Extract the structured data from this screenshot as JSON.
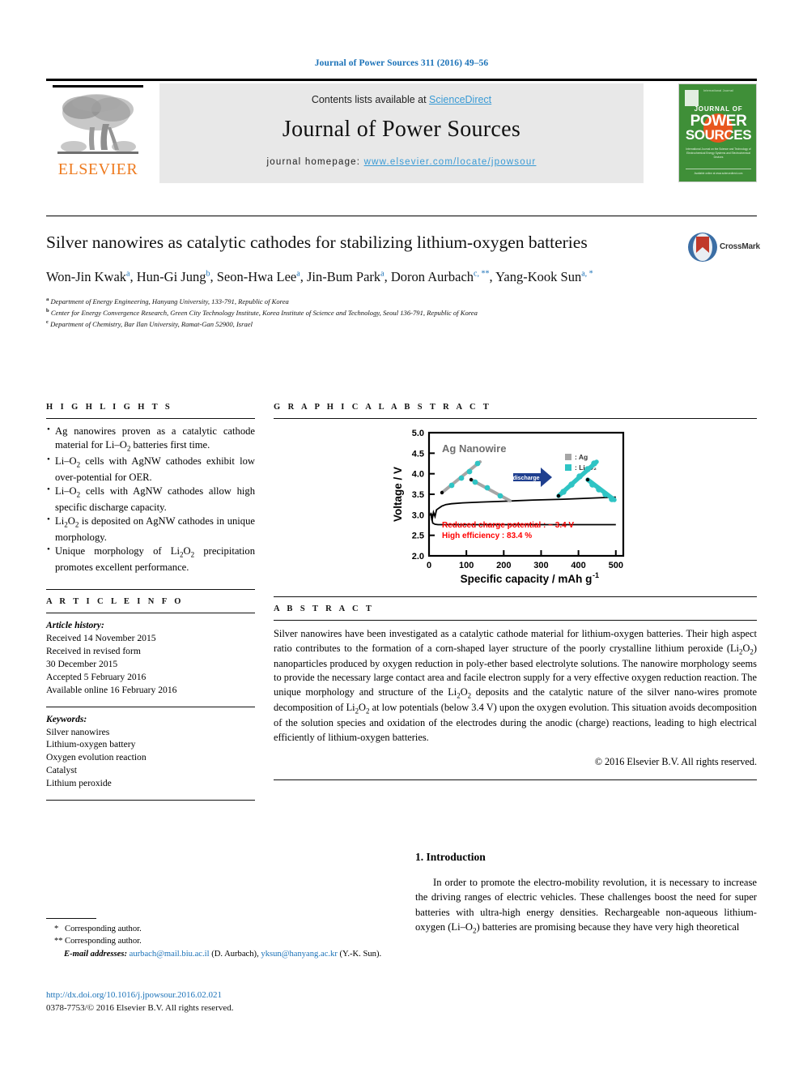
{
  "running_head": "Journal of Power Sources 311 (2016) 49–56",
  "masthead": {
    "contents_prefix": "Contents lists available at ",
    "sciencedirect": "ScienceDirect",
    "journal_name": "Journal of Power Sources",
    "homepage_label": "journal homepage: ",
    "homepage_url": "www.elsevier.com/locate/jpowsour",
    "elsevier_wordmark": "ELSEVIER",
    "elsevier_orange": "#ee7b20",
    "link_blue": "#3a9bd5"
  },
  "cover": {
    "top_line": "International Journal",
    "jof": "JOURNAL OF",
    "power": "POWER",
    "sources": "SOURCES",
    "subtitle": "International Journal on the Science and Technology of Electrochemical Energy Systems and Electrochemical Devices",
    "footer": "Available online at www.sciencedirect.com",
    "bg_color": "#3f8f38",
    "accent_color": "#e8561e"
  },
  "crossmark": {
    "label": "CrossMark"
  },
  "article": {
    "title": "Silver nanowires as catalytic cathodes for stabilizing lithium-oxygen batteries",
    "authors": [
      {
        "name": "Won-Jin Kwak",
        "marks": "a"
      },
      {
        "name": "Hun-Gi Jung",
        "marks": "b"
      },
      {
        "name": "Seon-Hwa Lee",
        "marks": "a"
      },
      {
        "name": "Jin-Bum Park",
        "marks": "a"
      },
      {
        "name": "Doron Aurbach",
        "marks": "c, **"
      },
      {
        "name": "Yang-Kook Sun",
        "marks": "a, *"
      }
    ],
    "affiliations": [
      {
        "mark": "a",
        "text": "Department of Energy Engineering, Hanyang University, 133-791, Republic of Korea"
      },
      {
        "mark": "b",
        "text": "Center for Energy Convergence Research, Green City Technology Institute, Korea Institute of Science and Technology, Seoul 136-791, Republic of Korea"
      },
      {
        "mark": "c",
        "text": "Department of Chemistry, Bar Ilan University, Ramat-Gan 52900, Israel"
      }
    ]
  },
  "highlights": {
    "heading": "H I G H L I G H T S",
    "items": [
      "Ag nanowires proven as a catalytic cathode material for Li–O<sub>2</sub> batteries first time.",
      "Li–O<sub>2</sub> cells with AgNW cathodes exhibit low over-potential for OER.",
      "Li–O<sub>2</sub> cells with AgNW cathodes allow high specific discharge capacity.",
      "Li<sub>2</sub>O<sub>2</sub> is deposited on AgNW cathodes in unique morphology.",
      "Unique morphology of Li<sub>2</sub>O<sub>2</sub> precipitation promotes excellent performance."
    ]
  },
  "graphical_abstract": {
    "heading": "G R A P H I C A L  A B S T R A C T"
  },
  "chart_data": {
    "type": "line",
    "title": "Ag Nanowire",
    "xlabel": "Specific capacity / mAh g",
    "xlabel_sup": "-1",
    "ylabel": "Voltage / V",
    "xlim": [
      0,
      520
    ],
    "ylim": [
      2.0,
      5.0
    ],
    "xticks": [
      0,
      100,
      200,
      300,
      400,
      500
    ],
    "yticks": [
      "2.0",
      "2.5",
      "3.0",
      "3.5",
      "4.0",
      "4.5",
      "5.0"
    ],
    "grid": false,
    "legend_position": "top-right",
    "legend": [
      {
        "label": ": Ag",
        "color": "#a6a6a6"
      },
      {
        "label": ": Li₂O₂",
        "color": "#2fc4c4"
      }
    ],
    "annotations": [
      {
        "text": "Reduced charge potential : ~ 3.4 V",
        "color": "#ff0000"
      },
      {
        "text": "High efficiency : 83.4 %",
        "color": "#ff0000"
      }
    ],
    "arrow_label": "discharge",
    "arrow_color": "#1f3f8f",
    "series": [
      {
        "name": "charge",
        "x": [
          5,
          8,
          12,
          16,
          20,
          26,
          34,
          45,
          60,
          90,
          140,
          200,
          280,
          360,
          440,
          500
        ],
        "y": [
          3.05,
          2.86,
          3.06,
          2.96,
          3.12,
          3.16,
          3.21,
          3.25,
          3.27,
          3.29,
          3.31,
          3.33,
          3.36,
          3.38,
          3.41,
          3.43
        ]
      },
      {
        "name": "discharge",
        "x": [
          5,
          10,
          16,
          24,
          40,
          80,
          160,
          260,
          360,
          450,
          500
        ],
        "y": [
          3.02,
          2.8,
          2.77,
          2.76,
          2.76,
          2.76,
          2.76,
          2.76,
          2.76,
          2.76,
          2.76
        ]
      }
    ]
  },
  "article_info": {
    "heading": "A R T I C L E  I N F O",
    "history_label": "Article history:",
    "history": [
      "Received 14 November 2015",
      "Received in revised form",
      "30 December 2015",
      "Accepted 5 February 2016",
      "Available online 16 February 2016"
    ],
    "keywords_label": "Keywords:",
    "keywords": [
      "Silver nanowires",
      "Lithium-oxygen battery",
      "Oxygen evolution reaction",
      "Catalyst",
      "Lithium peroxide"
    ]
  },
  "abstract": {
    "heading": "A B S T R A C T",
    "body": "Silver nanowires have been investigated as a catalytic cathode material for lithium-oxygen batteries. Their high aspect ratio contributes to the formation of a corn-shaped layer structure of the poorly crystalline lithium peroxide (Li<sub>2</sub>O<sub>2</sub>) nanoparticles produced by oxygen reduction in poly-ether based electrolyte solutions. The nanowire morphology seems to provide the necessary large contact area and facile electron supply for a very effective oxygen reduction reaction. The unique morphology and structure of the Li<sub>2</sub>O<sub>2</sub> deposits and the catalytic nature of the silver nano-wires promote decomposition of Li<sub>2</sub>O<sub>2</sub> at low potentials (below 3.4 V) upon the oxygen evolution. This situation avoids decomposition of the solution species and oxidation of the electrodes during the anodic (charge) reactions, leading to high electrical efficiently of lithium-oxygen batteries.",
    "copyright": "© 2016 Elsevier B.V. All rights reserved."
  },
  "introduction": {
    "heading": "1.  Introduction",
    "body": "In order to promote the electro-mobility revolution, it is necessary to increase the driving ranges of electric vehicles. These challenges boost the need for super batteries with ultra-high energy densities. Rechargeable non-aqueous lithium-oxygen (Li–O<sub>2</sub>) batteries are promising because they have very high theoretical"
  },
  "footnotes": {
    "corr1": "Corresponding author.",
    "corr2": "Corresponding author.",
    "star1": "*",
    "star2": "**",
    "email_label": "E-mail addresses:",
    "email1": "aurbach@mail.biu.ac.il",
    "email1_owner": "(D. Aurbach),",
    "email2": "yksun@hanyang.ac.kr",
    "email2_owner": "(Y.-K. Sun).",
    "doi": "http://dx.doi.org/10.1016/j.jpowsour.2016.02.021",
    "issn": "0378-7753/© 2016 Elsevier B.V. All rights reserved."
  }
}
